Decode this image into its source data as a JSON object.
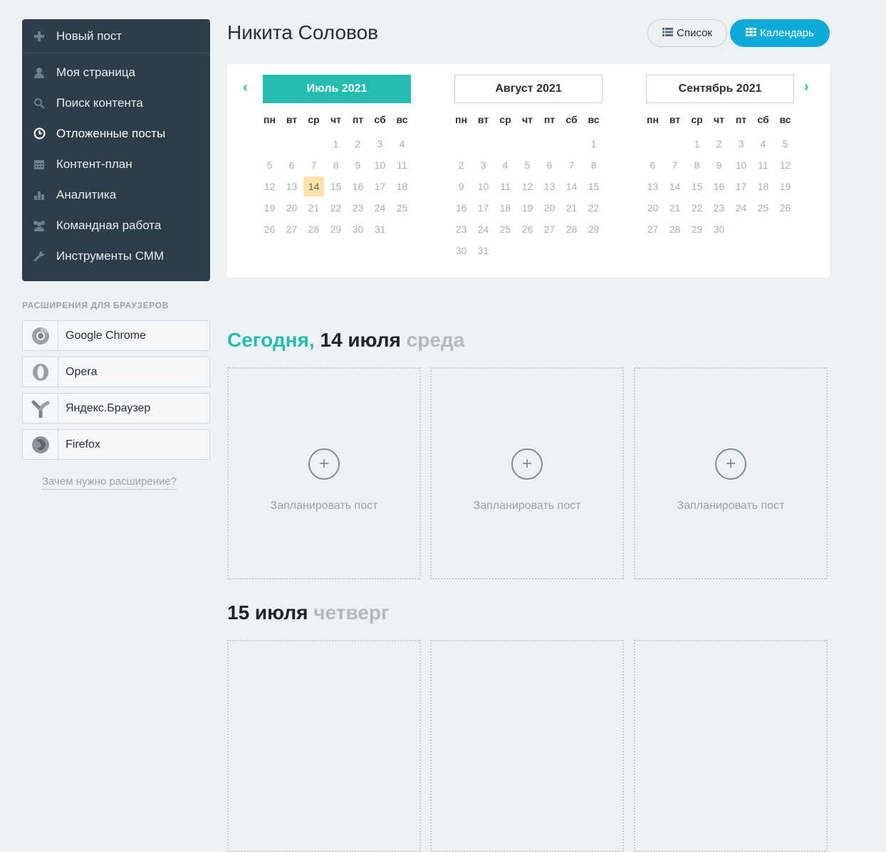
{
  "sidebar": {
    "items": [
      {
        "label": "Новый пост",
        "icon": "plus-icon"
      },
      {
        "label": "Моя страница",
        "icon": "user-icon"
      },
      {
        "label": "Поиск контента",
        "icon": "search-icon"
      },
      {
        "label": "Отложенные посты",
        "icon": "clock-icon"
      },
      {
        "label": "Контент-план",
        "icon": "calendar-icon"
      },
      {
        "label": "Аналитика",
        "icon": "bar-chart-icon"
      },
      {
        "label": "Командная работа",
        "icon": "team-icon"
      },
      {
        "label": "Инструменты СММ",
        "icon": "wrench-icon"
      }
    ]
  },
  "extensions": {
    "title": "РАСШИРЕНИЯ ДЛЯ БРАУЗЕРОВ",
    "items": [
      {
        "label": "Google Chrome",
        "icon": "chrome-icon"
      },
      {
        "label": "Opera",
        "icon": "opera-icon"
      },
      {
        "label": "Яндекс.Браузер",
        "icon": "yandex-browser-icon"
      },
      {
        "label": "Firefox",
        "icon": "firefox-icon"
      }
    ],
    "why_link": "Зачем нужно расширение?"
  },
  "header": {
    "title": "Никита Соловов",
    "list_button": "Список",
    "calendar_button": "Календарь"
  },
  "calendar": {
    "weekdays": [
      "пн",
      "вт",
      "ср",
      "чт",
      "пт",
      "сб",
      "вс"
    ],
    "today": 14,
    "months": [
      {
        "label": "Июль 2021",
        "offset": 3,
        "days": 31,
        "active": true
      },
      {
        "label": "Август 2021",
        "offset": 6,
        "days": 31,
        "active": false
      },
      {
        "label": "Сентябрь 2021",
        "offset": 2,
        "days": 30,
        "active": false
      }
    ]
  },
  "days": [
    {
      "today_word": "Сегодня,",
      "date": "14 июля",
      "weekday": "среда"
    },
    {
      "today_word": "",
      "date": "15 июля",
      "weekday": "четверг"
    }
  ],
  "slot_label": "Запланировать пост",
  "colors": {
    "accent": "#25bdb1",
    "primary_button": "#0cabd9",
    "sidebar_bg": "#2d3e48",
    "today_cell": "#fbe2a8"
  }
}
